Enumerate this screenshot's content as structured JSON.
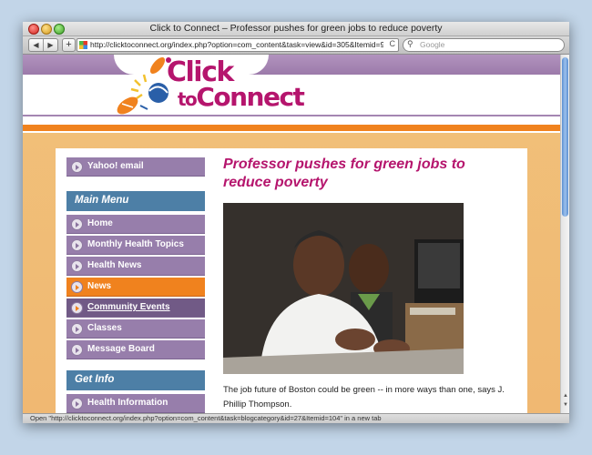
{
  "window": {
    "title": "Click to Connect – Professor pushes for green jobs to reduce poverty"
  },
  "toolbar": {
    "back": "◀",
    "forward": "▶",
    "add": "+",
    "url": "http://clicktoconnect.org/index.php?option=com_content&task=view&id=305&Itemid=9",
    "reload": "C",
    "search_placeholder": "Google",
    "search_icon": "magnifier-icon"
  },
  "logo": {
    "line1": "Click",
    "line2_small": "to",
    "line2": "Connect"
  },
  "sidebar": {
    "top_item": "Yahoo! email",
    "main_menu_title": "Main Menu",
    "main_menu": [
      {
        "label": "Home"
      },
      {
        "label": "Monthly Health Topics"
      },
      {
        "label": "Health News"
      },
      {
        "label": "News"
      },
      {
        "label": "Community Events"
      },
      {
        "label": "Classes"
      },
      {
        "label": "Message Board"
      }
    ],
    "get_info_title": "Get Info",
    "get_info": [
      {
        "label": "Health Information"
      }
    ]
  },
  "article": {
    "title": "Professor pushes for green jobs to reduce poverty",
    "body": "The job future of Boston could be green -- in more ways than one, says J. Phillip Thompson."
  },
  "status": {
    "text": "Open \"http://clicktoconnect.org/index.php?option=com_content&task=blogcategory&id=27&Itemid=104\" in a new tab"
  },
  "colors": {
    "brand_magenta": "#b5156d",
    "menu_purple": "#977eab",
    "active_orange": "#f0821e",
    "menu_header_blue": "#4d7fa6"
  }
}
